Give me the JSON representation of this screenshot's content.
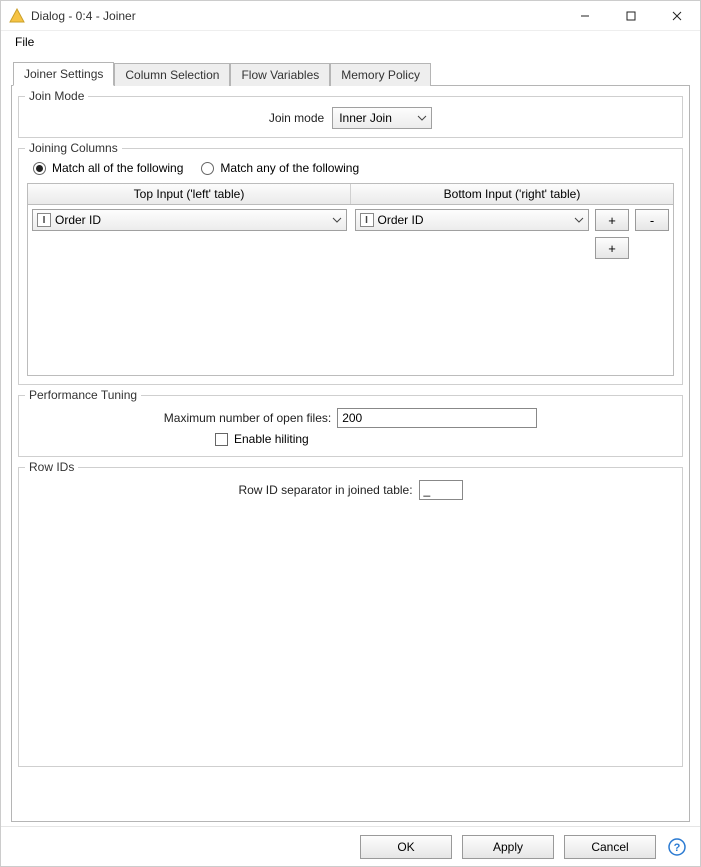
{
  "window": {
    "title": "Dialog - 0:4 - Joiner"
  },
  "menubar": {
    "file": "File"
  },
  "tabs": [
    {
      "label": "Joiner Settings"
    },
    {
      "label": "Column Selection"
    },
    {
      "label": "Flow Variables"
    },
    {
      "label": "Memory Policy"
    }
  ],
  "join_mode": {
    "group_title": "Join Mode",
    "label": "Join mode",
    "value": "Inner Join"
  },
  "joining_columns": {
    "group_title": "Joining Columns",
    "match_all_label": "Match all of the following",
    "match_any_label": "Match any of the following",
    "match_all_selected": true,
    "header_left": "Top Input ('left' table)",
    "header_right": "Bottom Input ('right' table)",
    "left_value": "Order ID",
    "right_value": "Order ID",
    "left_type_badge": "I",
    "right_type_badge": "I",
    "btn_plus": "+",
    "btn_minus": "-",
    "btn_plus2": "+"
  },
  "performance": {
    "group_title": "Performance Tuning",
    "max_open_label": "Maximum number of open files:",
    "max_open_value": "200",
    "enable_hiliting_label": "Enable hiliting",
    "enable_hiliting_checked": false
  },
  "row_ids": {
    "group_title": "Row IDs",
    "separator_label": "Row ID separator in joined table:",
    "separator_value": "_"
  },
  "buttons": {
    "ok": "OK",
    "apply": "Apply",
    "cancel": "Cancel"
  }
}
